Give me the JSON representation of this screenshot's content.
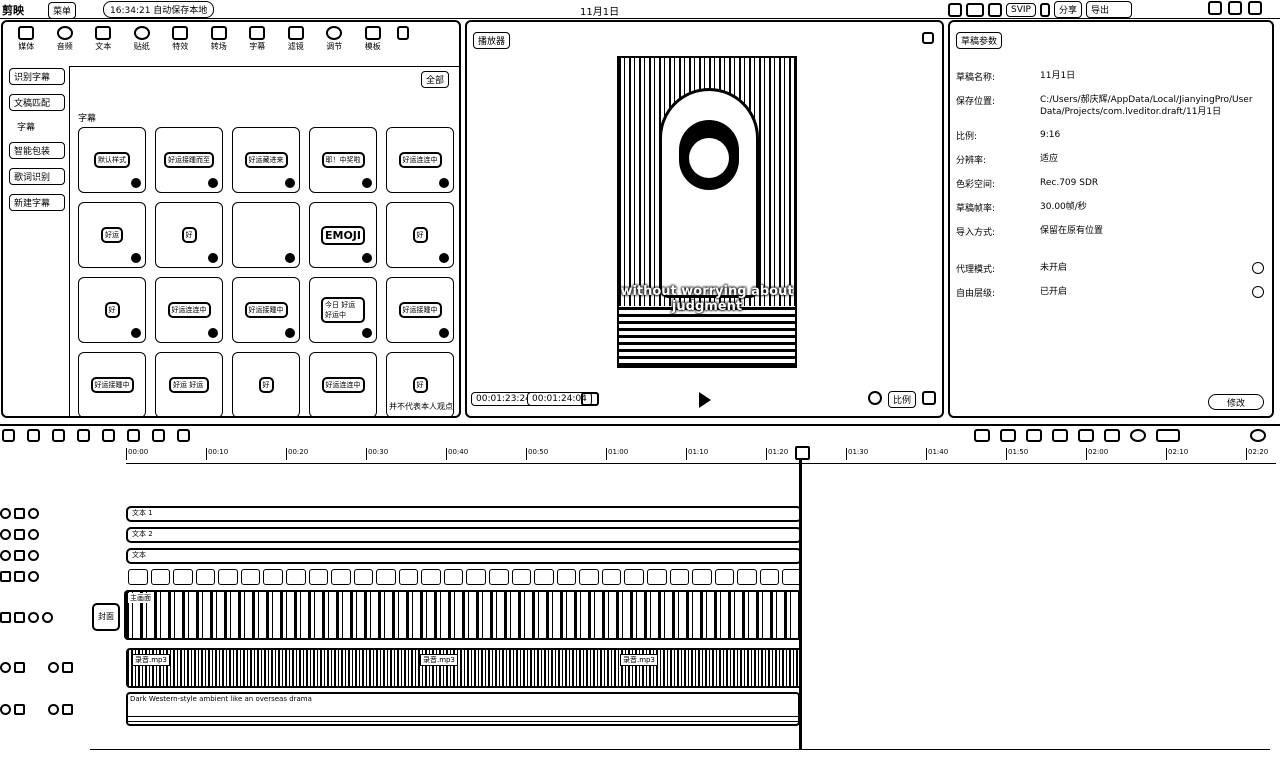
{
  "app": {
    "title": "剪映",
    "menu_label": "菜单",
    "autosave_text": "16:34:21 自动保存本地",
    "project_name": "11月1日",
    "svip_label": "SVIP",
    "share_label": "分享",
    "export_label": "导出"
  },
  "toolbar": {
    "tabs": [
      {
        "label": "媒体",
        "icon": "media-icon"
      },
      {
        "label": "音频",
        "icon": "audio-icon"
      },
      {
        "label": "文本",
        "icon": "text-icon"
      },
      {
        "label": "贴纸",
        "icon": "sticker-icon"
      },
      {
        "label": "特效",
        "icon": "effects-icon"
      },
      {
        "label": "转场",
        "icon": "transition-icon"
      },
      {
        "label": "字幕",
        "icon": "caption-icon"
      },
      {
        "label": "滤镜",
        "icon": "filter-icon"
      },
      {
        "label": "调节",
        "icon": "adjust-icon"
      },
      {
        "label": "模板",
        "icon": "template-icon"
      }
    ]
  },
  "media": {
    "side_items": [
      "识别字幕",
      "文稿匹配",
      "字幕",
      "智能包装",
      "歌词识别",
      "新建字幕"
    ],
    "filter_label": "全部",
    "section_label": "字幕",
    "footer_text": "并不代表本人观点",
    "tiles": [
      [
        "默认样式",
        "好运接踵而至",
        "好运藏进来",
        "耶！中奖啦",
        "好运连连中"
      ],
      [
        "好运",
        "好",
        "",
        "EMOJI",
        "好"
      ],
      [
        "好",
        "好运连连中",
        "好运接踵中",
        "今日 好运 好运中",
        "好运接踵中"
      ],
      [
        "好运接踵中",
        "好运 好运",
        "好",
        "好运连连中",
        "好"
      ]
    ]
  },
  "player": {
    "title": "播放器",
    "subtitle_line1": "without worrying about",
    "subtitle_line2": "judgment",
    "current_time": "00:01:23:24",
    "total_time": "00:01:24:04",
    "ratio_label": "比例"
  },
  "params": {
    "title": "草稿参数",
    "rows": [
      {
        "label": "草稿名称:",
        "value": "11月1日"
      },
      {
        "label": "保存位置:",
        "value": "C:/Users/郝庆辉/AppData/Local/JianyingPro/User Data/Projects/com.lveditor.draft/11月1日"
      },
      {
        "label": "比例:",
        "value": "9:16"
      },
      {
        "label": "分辨率:",
        "value": "适应"
      },
      {
        "label": "色彩空间:",
        "value": "Rec.709 SDR"
      },
      {
        "label": "草稿帧率:",
        "value": "30.00帧/秒"
      },
      {
        "label": "导入方式:",
        "value": "保留在原有位置"
      },
      {
        "label": "代理模式:",
        "value": "未开启"
      },
      {
        "label": "自由层级:",
        "value": "已开启"
      }
    ],
    "edit_label": "修改"
  },
  "timeline": {
    "ruler": [
      "00:00",
      "00:10",
      "00:20",
      "00:30",
      "00:40",
      "00:50",
      "01:00",
      "01:10",
      "01:20",
      "01:30",
      "01:40",
      "01:50",
      "02:00",
      "02:10",
      "02:20"
    ],
    "text_track_1": "文本 1",
    "text_track_2": "文本 2",
    "text_track_3": "文本",
    "video_file": "主画面",
    "cover_label": "封面",
    "audio_file_1": "录音.mp3",
    "audio_file_2": "录音.mp3",
    "audio_file_3": "录音.mp3",
    "music_label": "Dark Western-style ambient like an overseas drama",
    "sub_clip_count": 30
  }
}
